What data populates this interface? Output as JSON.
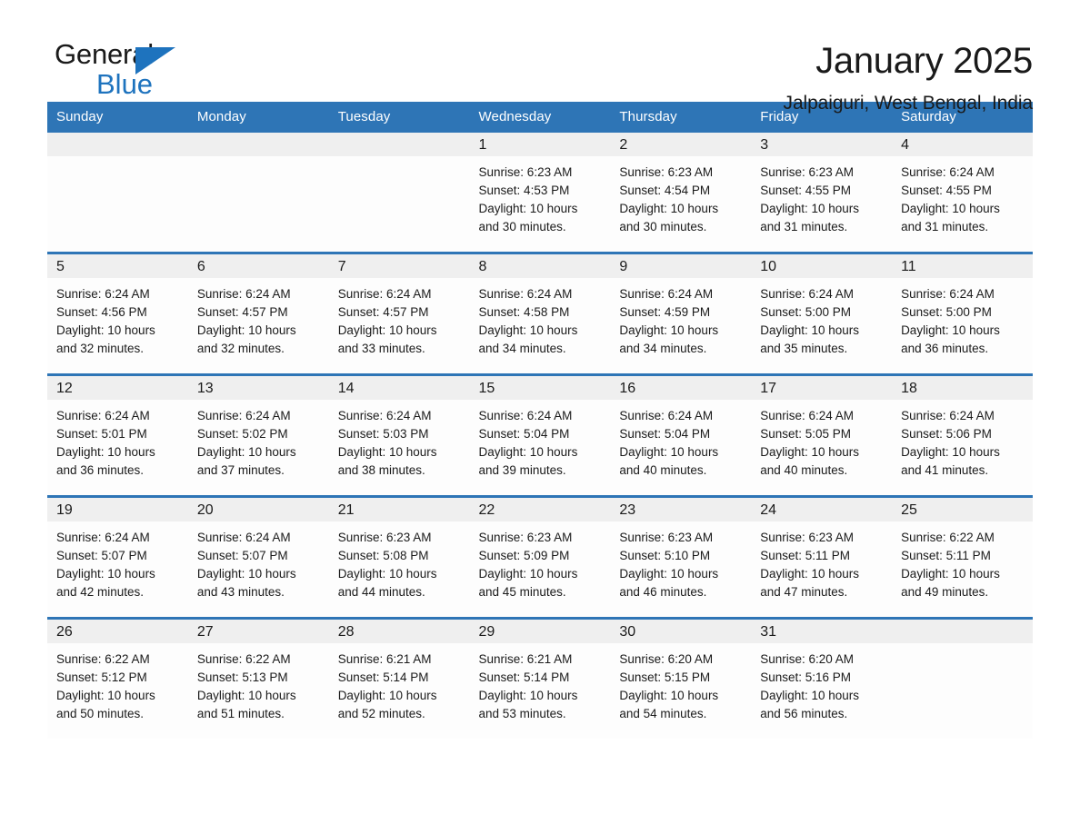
{
  "brand": {
    "name_part1": "General",
    "name_part2": "Blue"
  },
  "header": {
    "title": "January 2025",
    "subtitle": "Jalpaiguri, West Bengal, India"
  },
  "colors": {
    "header_blue": "#2e75b6",
    "brand_blue": "#1e73be",
    "daynum_band": "#efefef"
  },
  "weekday_headers": [
    "Sunday",
    "Monday",
    "Tuesday",
    "Wednesday",
    "Thursday",
    "Friday",
    "Saturday"
  ],
  "weeks": [
    [
      {
        "day": "",
        "sunrise": "",
        "sunset": "",
        "daylight_line1": "",
        "daylight_line2": "",
        "empty": true
      },
      {
        "day": "",
        "sunrise": "",
        "sunset": "",
        "daylight_line1": "",
        "daylight_line2": "",
        "empty": true
      },
      {
        "day": "",
        "sunrise": "",
        "sunset": "",
        "daylight_line1": "",
        "daylight_line2": "",
        "empty": true
      },
      {
        "day": "1",
        "sunrise": "Sunrise: 6:23 AM",
        "sunset": "Sunset: 4:53 PM",
        "daylight_line1": "Daylight: 10 hours",
        "daylight_line2": "and 30 minutes.",
        "empty": false
      },
      {
        "day": "2",
        "sunrise": "Sunrise: 6:23 AM",
        "sunset": "Sunset: 4:54 PM",
        "daylight_line1": "Daylight: 10 hours",
        "daylight_line2": "and 30 minutes.",
        "empty": false
      },
      {
        "day": "3",
        "sunrise": "Sunrise: 6:23 AM",
        "sunset": "Sunset: 4:55 PM",
        "daylight_line1": "Daylight: 10 hours",
        "daylight_line2": "and 31 minutes.",
        "empty": false
      },
      {
        "day": "4",
        "sunrise": "Sunrise: 6:24 AM",
        "sunset": "Sunset: 4:55 PM",
        "daylight_line1": "Daylight: 10 hours",
        "daylight_line2": "and 31 minutes.",
        "empty": false
      }
    ],
    [
      {
        "day": "5",
        "sunrise": "Sunrise: 6:24 AM",
        "sunset": "Sunset: 4:56 PM",
        "daylight_line1": "Daylight: 10 hours",
        "daylight_line2": "and 32 minutes.",
        "empty": false
      },
      {
        "day": "6",
        "sunrise": "Sunrise: 6:24 AM",
        "sunset": "Sunset: 4:57 PM",
        "daylight_line1": "Daylight: 10 hours",
        "daylight_line2": "and 32 minutes.",
        "empty": false
      },
      {
        "day": "7",
        "sunrise": "Sunrise: 6:24 AM",
        "sunset": "Sunset: 4:57 PM",
        "daylight_line1": "Daylight: 10 hours",
        "daylight_line2": "and 33 minutes.",
        "empty": false
      },
      {
        "day": "8",
        "sunrise": "Sunrise: 6:24 AM",
        "sunset": "Sunset: 4:58 PM",
        "daylight_line1": "Daylight: 10 hours",
        "daylight_line2": "and 34 minutes.",
        "empty": false
      },
      {
        "day": "9",
        "sunrise": "Sunrise: 6:24 AM",
        "sunset": "Sunset: 4:59 PM",
        "daylight_line1": "Daylight: 10 hours",
        "daylight_line2": "and 34 minutes.",
        "empty": false
      },
      {
        "day": "10",
        "sunrise": "Sunrise: 6:24 AM",
        "sunset": "Sunset: 5:00 PM",
        "daylight_line1": "Daylight: 10 hours",
        "daylight_line2": "and 35 minutes.",
        "empty": false
      },
      {
        "day": "11",
        "sunrise": "Sunrise: 6:24 AM",
        "sunset": "Sunset: 5:00 PM",
        "daylight_line1": "Daylight: 10 hours",
        "daylight_line2": "and 36 minutes.",
        "empty": false
      }
    ],
    [
      {
        "day": "12",
        "sunrise": "Sunrise: 6:24 AM",
        "sunset": "Sunset: 5:01 PM",
        "daylight_line1": "Daylight: 10 hours",
        "daylight_line2": "and 36 minutes.",
        "empty": false
      },
      {
        "day": "13",
        "sunrise": "Sunrise: 6:24 AM",
        "sunset": "Sunset: 5:02 PM",
        "daylight_line1": "Daylight: 10 hours",
        "daylight_line2": "and 37 minutes.",
        "empty": false
      },
      {
        "day": "14",
        "sunrise": "Sunrise: 6:24 AM",
        "sunset": "Sunset: 5:03 PM",
        "daylight_line1": "Daylight: 10 hours",
        "daylight_line2": "and 38 minutes.",
        "empty": false
      },
      {
        "day": "15",
        "sunrise": "Sunrise: 6:24 AM",
        "sunset": "Sunset: 5:04 PM",
        "daylight_line1": "Daylight: 10 hours",
        "daylight_line2": "and 39 minutes.",
        "empty": false
      },
      {
        "day": "16",
        "sunrise": "Sunrise: 6:24 AM",
        "sunset": "Sunset: 5:04 PM",
        "daylight_line1": "Daylight: 10 hours",
        "daylight_line2": "and 40 minutes.",
        "empty": false
      },
      {
        "day": "17",
        "sunrise": "Sunrise: 6:24 AM",
        "sunset": "Sunset: 5:05 PM",
        "daylight_line1": "Daylight: 10 hours",
        "daylight_line2": "and 40 minutes.",
        "empty": false
      },
      {
        "day": "18",
        "sunrise": "Sunrise: 6:24 AM",
        "sunset": "Sunset: 5:06 PM",
        "daylight_line1": "Daylight: 10 hours",
        "daylight_line2": "and 41 minutes.",
        "empty": false
      }
    ],
    [
      {
        "day": "19",
        "sunrise": "Sunrise: 6:24 AM",
        "sunset": "Sunset: 5:07 PM",
        "daylight_line1": "Daylight: 10 hours",
        "daylight_line2": "and 42 minutes.",
        "empty": false
      },
      {
        "day": "20",
        "sunrise": "Sunrise: 6:24 AM",
        "sunset": "Sunset: 5:07 PM",
        "daylight_line1": "Daylight: 10 hours",
        "daylight_line2": "and 43 minutes.",
        "empty": false
      },
      {
        "day": "21",
        "sunrise": "Sunrise: 6:23 AM",
        "sunset": "Sunset: 5:08 PM",
        "daylight_line1": "Daylight: 10 hours",
        "daylight_line2": "and 44 minutes.",
        "empty": false
      },
      {
        "day": "22",
        "sunrise": "Sunrise: 6:23 AM",
        "sunset": "Sunset: 5:09 PM",
        "daylight_line1": "Daylight: 10 hours",
        "daylight_line2": "and 45 minutes.",
        "empty": false
      },
      {
        "day": "23",
        "sunrise": "Sunrise: 6:23 AM",
        "sunset": "Sunset: 5:10 PM",
        "daylight_line1": "Daylight: 10 hours",
        "daylight_line2": "and 46 minutes.",
        "empty": false
      },
      {
        "day": "24",
        "sunrise": "Sunrise: 6:23 AM",
        "sunset": "Sunset: 5:11 PM",
        "daylight_line1": "Daylight: 10 hours",
        "daylight_line2": "and 47 minutes.",
        "empty": false
      },
      {
        "day": "25",
        "sunrise": "Sunrise: 6:22 AM",
        "sunset": "Sunset: 5:11 PM",
        "daylight_line1": "Daylight: 10 hours",
        "daylight_line2": "and 49 minutes.",
        "empty": false
      }
    ],
    [
      {
        "day": "26",
        "sunrise": "Sunrise: 6:22 AM",
        "sunset": "Sunset: 5:12 PM",
        "daylight_line1": "Daylight: 10 hours",
        "daylight_line2": "and 50 minutes.",
        "empty": false
      },
      {
        "day": "27",
        "sunrise": "Sunrise: 6:22 AM",
        "sunset": "Sunset: 5:13 PM",
        "daylight_line1": "Daylight: 10 hours",
        "daylight_line2": "and 51 minutes.",
        "empty": false
      },
      {
        "day": "28",
        "sunrise": "Sunrise: 6:21 AM",
        "sunset": "Sunset: 5:14 PM",
        "daylight_line1": "Daylight: 10 hours",
        "daylight_line2": "and 52 minutes.",
        "empty": false
      },
      {
        "day": "29",
        "sunrise": "Sunrise: 6:21 AM",
        "sunset": "Sunset: 5:14 PM",
        "daylight_line1": "Daylight: 10 hours",
        "daylight_line2": "and 53 minutes.",
        "empty": false
      },
      {
        "day": "30",
        "sunrise": "Sunrise: 6:20 AM",
        "sunset": "Sunset: 5:15 PM",
        "daylight_line1": "Daylight: 10 hours",
        "daylight_line2": "and 54 minutes.",
        "empty": false
      },
      {
        "day": "31",
        "sunrise": "Sunrise: 6:20 AM",
        "sunset": "Sunset: 5:16 PM",
        "daylight_line1": "Daylight: 10 hours",
        "daylight_line2": "and 56 minutes.",
        "empty": false
      },
      {
        "day": "",
        "sunrise": "",
        "sunset": "",
        "daylight_line1": "",
        "daylight_line2": "",
        "empty": true
      }
    ]
  ]
}
